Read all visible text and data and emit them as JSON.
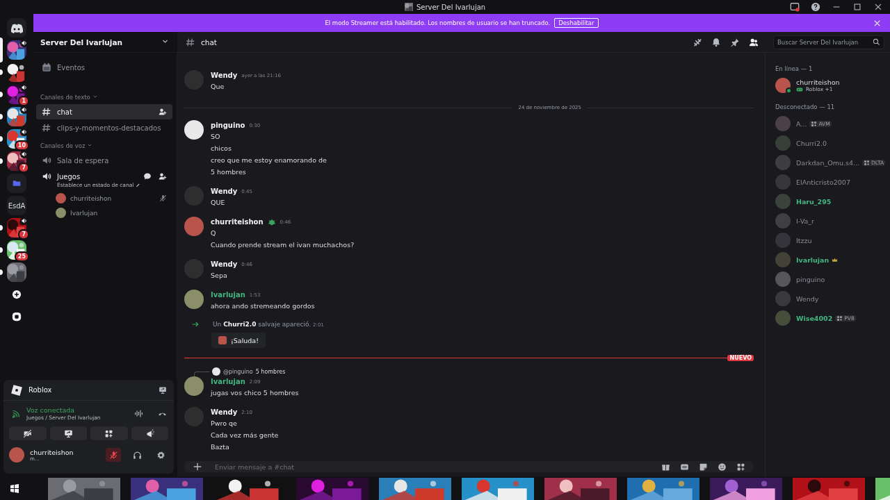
{
  "window": {
    "title": "Server Del Ivarlujan"
  },
  "streamer_banner": {
    "text": "El modo Streamer está habilitado. Los nombres de usuario se han truncado.",
    "button": "Deshabilitar"
  },
  "server_rail": [
    {
      "kind": "home",
      "selected": false
    },
    {
      "kind": "server",
      "selected": true,
      "voice": true
    },
    {
      "kind": "server",
      "selected": false,
      "unread": true,
      "voice": false
    },
    {
      "kind": "server",
      "selected": false,
      "unread": true,
      "voice": true,
      "badge": "1"
    },
    {
      "kind": "server",
      "selected": false,
      "unread": true,
      "voice": true
    },
    {
      "kind": "server",
      "selected": false,
      "unread": true,
      "voice": true,
      "badge": "10"
    },
    {
      "kind": "server",
      "selected": false,
      "unread": true,
      "voice": true,
      "badge": "7"
    },
    {
      "kind": "folder",
      "selected": false
    },
    {
      "kind": "text",
      "label": "EsdA",
      "selected": false
    },
    {
      "kind": "server",
      "selected": false,
      "unread": true,
      "voice": true,
      "badge": "7"
    },
    {
      "kind": "server",
      "selected": false,
      "unread": true,
      "voice": false,
      "badge": "25"
    },
    {
      "kind": "server",
      "selected": false,
      "unread": true,
      "voice": false
    },
    {
      "kind": "add",
      "selected": false
    },
    {
      "kind": "discover",
      "selected": false
    }
  ],
  "sidebar": {
    "server_name": "Server Del Ivarlujan",
    "items": [
      {
        "kind": "events",
        "label": "Eventos"
      },
      {
        "kind": "category",
        "label": "Canales de texto"
      },
      {
        "kind": "text",
        "label": "chat",
        "selected": true
      },
      {
        "kind": "text",
        "label": "clips-y-momentos-destacados",
        "selected": false
      },
      {
        "kind": "category",
        "label": "Canales de voz"
      },
      {
        "kind": "voice",
        "label": "Sala de espera",
        "selected": false
      },
      {
        "kind": "voice",
        "label": "Juegos",
        "selected": true,
        "status": "Establece un estado de canal",
        "users": [
          {
            "name": "churriteishon",
            "muted": true
          },
          {
            "name": "Ivarlujan",
            "muted": false
          }
        ]
      }
    ]
  },
  "voice_panel": {
    "activity": "Roblox",
    "status": "Voz conectada",
    "location": "Juegos / Server Del Ivarlujan",
    "user": {
      "name": "churriteishon",
      "status": "m...",
      "mic_muted": true
    }
  },
  "chat_header": {
    "channel": "chat",
    "search_placeholder": "Buscar Server Del Ivarlujan"
  },
  "messages": [
    {
      "kind": "message",
      "author": "Wendy",
      "time": "ayer a las 21:16",
      "lines": [
        "Que"
      ]
    },
    {
      "kind": "date",
      "text": "24 de noviembre de 2025"
    },
    {
      "kind": "message",
      "author": "pinguino",
      "time": "0:30",
      "lines": [
        "SO",
        "chicos",
        "creo que me estoy enamorando de",
        "5 hombres"
      ]
    },
    {
      "kind": "message",
      "author": "Wendy",
      "time": "0:45",
      "lines": [
        "QUE"
      ]
    },
    {
      "kind": "message",
      "author": "churriteishon",
      "badge": true,
      "time": "0:46",
      "lines": [
        "Q",
        "Cuando prende stream el ivan muchachos?"
      ]
    },
    {
      "kind": "message",
      "author": "Wendy",
      "time": "0:46",
      "lines": [
        "Sepa"
      ]
    },
    {
      "kind": "message",
      "author": "Ivarlujan",
      "color": "#43b581",
      "time": "1:53",
      "lines": [
        "ahora ando stremeando gordos"
      ]
    },
    {
      "kind": "join",
      "before": "Un",
      "name": "Churri2.0",
      "after": "salvaje apareció.",
      "time": "2:01",
      "button": "¡Saluda!"
    },
    {
      "kind": "new",
      "label": "NUEVO"
    },
    {
      "kind": "message",
      "author": "Ivarlujan",
      "color": "#43b581",
      "time": "2:09",
      "reply": {
        "author": "@pinguino",
        "text": "5 hombres"
      },
      "lines": [
        "jugas vos chico 5 hombres"
      ]
    },
    {
      "kind": "message",
      "author": "Wendy",
      "time": "2:10",
      "lines": [
        "Pwro qe",
        "Cada vez más gente",
        "Bazta"
      ]
    }
  ],
  "composer": {
    "placeholder": "Enviar mensaje a #chat"
  },
  "members": [
    {
      "title": "En línea — 1",
      "online": true,
      "members": [
        {
          "name": "churriteishon",
          "activity": "Roblox +1"
        }
      ]
    },
    {
      "title": "Desconectado — 11",
      "online": false,
      "members": [
        {
          "name": "A...",
          "tag": "AVM"
        },
        {
          "name": "Churri2.0"
        },
        {
          "name": "Darkdan_Omu.s4...",
          "tag": "DLTA"
        },
        {
          "name": "ElAnticristo2007"
        },
        {
          "name": "Haru_295",
          "color": "#43b581"
        },
        {
          "name": "I-Va_r"
        },
        {
          "name": "Itzzu"
        },
        {
          "name": "Ivarlujan",
          "color": "#43b581",
          "owner": true
        },
        {
          "name": "pinguino"
        },
        {
          "name": "Wendy"
        },
        {
          "name": "Wise4002",
          "color": "#43b581",
          "tag": "PV8"
        }
      ]
    }
  ]
}
